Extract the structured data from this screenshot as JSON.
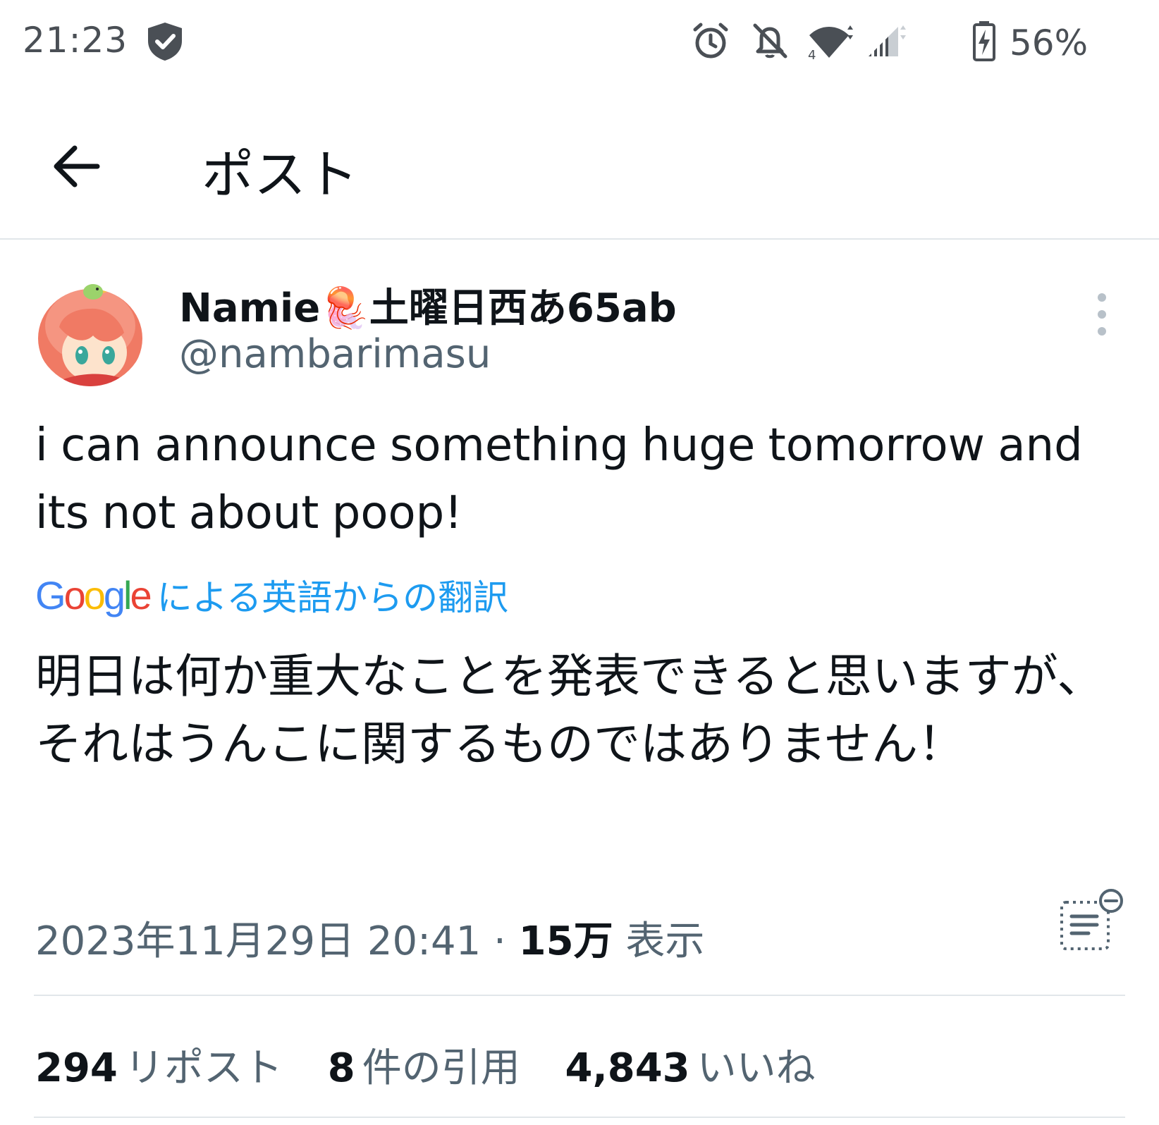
{
  "status_bar": {
    "time": "21:23",
    "battery_percent": "56%",
    "icons": [
      "shield-check-icon",
      "alarm-icon",
      "bell-off-icon",
      "wifi-icon",
      "signal-icon",
      "battery-charging-icon"
    ]
  },
  "header": {
    "back_icon": "arrow-left-icon",
    "title": "ポスト"
  },
  "tweet": {
    "display_name": "Namie🪼土曜日西あ65ab",
    "username": "@nambarimasu",
    "text": "i can announce something huge tomorrow and its not about poop!",
    "translation": {
      "provider": "Google",
      "label": "による英語からの翻訳",
      "text": "明日は何か重大なことを発表できると思いますが、それはうんこに関するものではありません！"
    },
    "timestamp": "2023年11月29日 20:41",
    "separator": "·",
    "views_count": "15万",
    "views_label": "表示",
    "stats": [
      {
        "count": "294",
        "label": "リポスト"
      },
      {
        "count": "8",
        "label": "件の引用"
      },
      {
        "count": "4,843",
        "label": "いいね"
      }
    ]
  },
  "colors": {
    "text_primary": "#0f1419",
    "text_secondary": "#536471",
    "link_blue": "#1d9bf0",
    "divider": "#e1e6ea"
  }
}
